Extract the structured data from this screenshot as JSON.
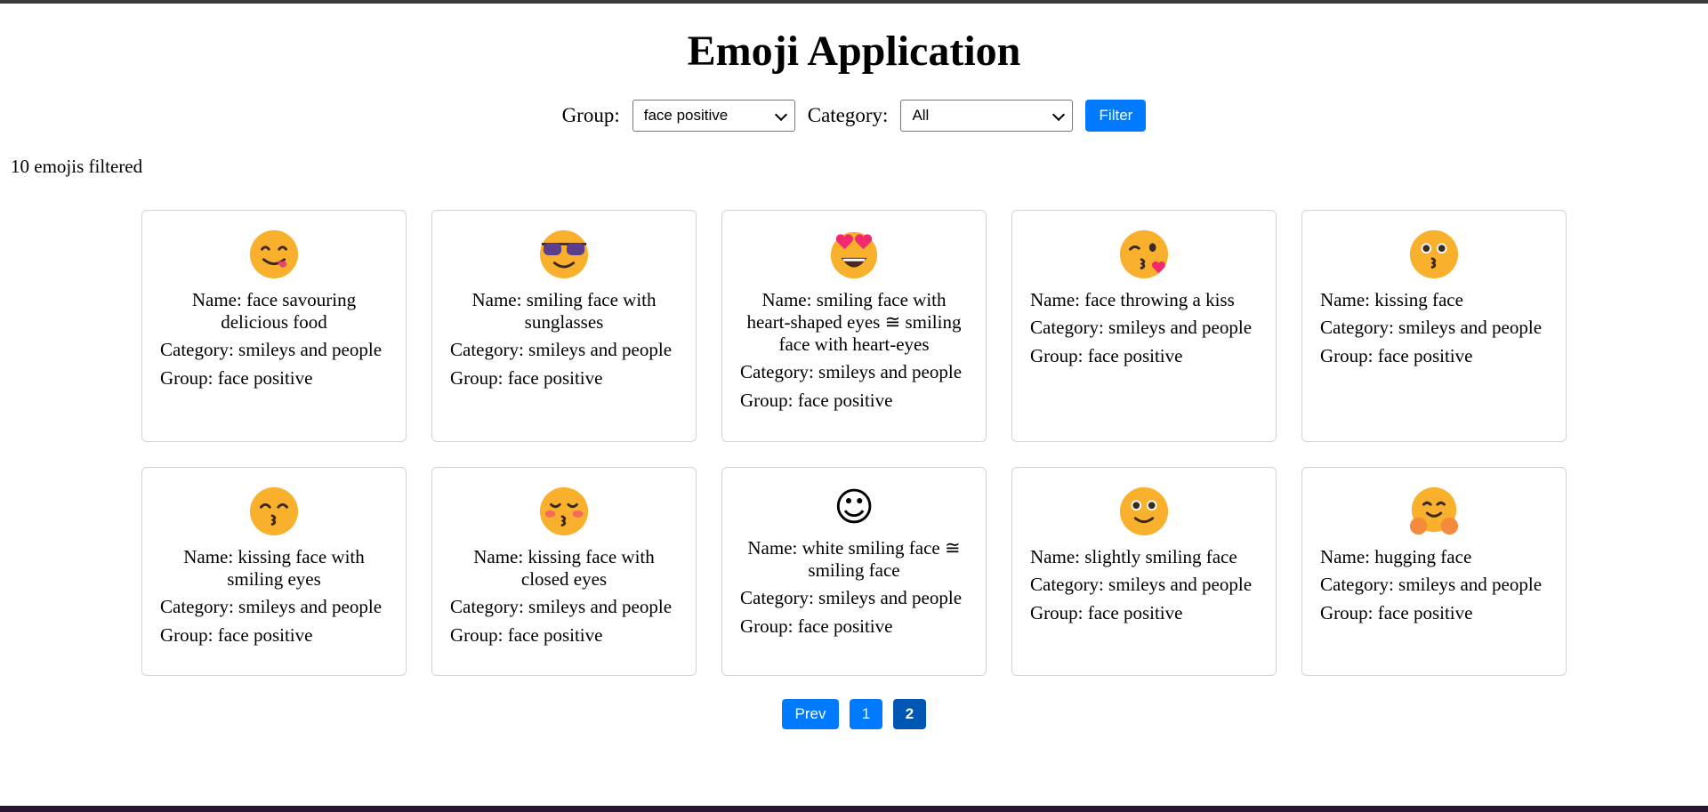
{
  "title": "Emoji Application",
  "filters": {
    "group_label": "Group:",
    "group_value": "face positive",
    "category_label": "Category:",
    "category_value": "All",
    "filter_button": "Filter"
  },
  "result_count": "10 emojis filtered",
  "emojis": [
    {
      "icon": "face-savouring-food-emoji",
      "name": "Name: face savouring delicious food",
      "category": "Category: smileys and people",
      "group": "Group: face positive"
    },
    {
      "icon": "sunglasses-face-emoji",
      "name": "Name: smiling face with sunglasses",
      "category": "Category: smileys and people",
      "group": "Group: face positive"
    },
    {
      "icon": "heart-eyes-face-emoji",
      "name": "Name: smiling face with heart-shaped eyes ≅ smiling face with heart-eyes",
      "category": "Category: smileys and people",
      "group": "Group: face positive"
    },
    {
      "icon": "face-throwing-kiss-emoji",
      "name": "Name: face throwing a kiss",
      "category": "Category: smileys and people",
      "group": "Group: face positive"
    },
    {
      "icon": "kissing-face-emoji",
      "name": "Name: kissing face",
      "category": "Category: smileys and people",
      "group": "Group: face positive"
    },
    {
      "icon": "kissing-smiling-eyes-emoji",
      "name": "Name: kissing face with smiling eyes",
      "category": "Category: smileys and people",
      "group": "Group: face positive"
    },
    {
      "icon": "kissing-closed-eyes-emoji",
      "name": "Name: kissing face with closed eyes",
      "category": "Category: smileys and people",
      "group": "Group: face positive"
    },
    {
      "icon": "white-smiling-face-glyph",
      "glyph": "☺",
      "name": "Name: white smiling face ≅ smiling face",
      "category": "Category: smileys and people",
      "group": "Group: face positive"
    },
    {
      "icon": "slightly-smiling-face-emoji",
      "name": "Name: slightly smiling face",
      "category": "Category: smileys and people",
      "group": "Group: face positive"
    },
    {
      "icon": "hugging-face-emoji",
      "name": "Name: hugging face",
      "category": "Category: smileys and people",
      "group": "Group: face positive"
    }
  ],
  "pagination": {
    "prev_label": "Prev",
    "pages": [
      "1",
      "2"
    ],
    "active_page": "2"
  },
  "colors": {
    "accent": "#007bff",
    "accent_active": "#0056b3",
    "emoji_yellow": "#f9b02c"
  }
}
